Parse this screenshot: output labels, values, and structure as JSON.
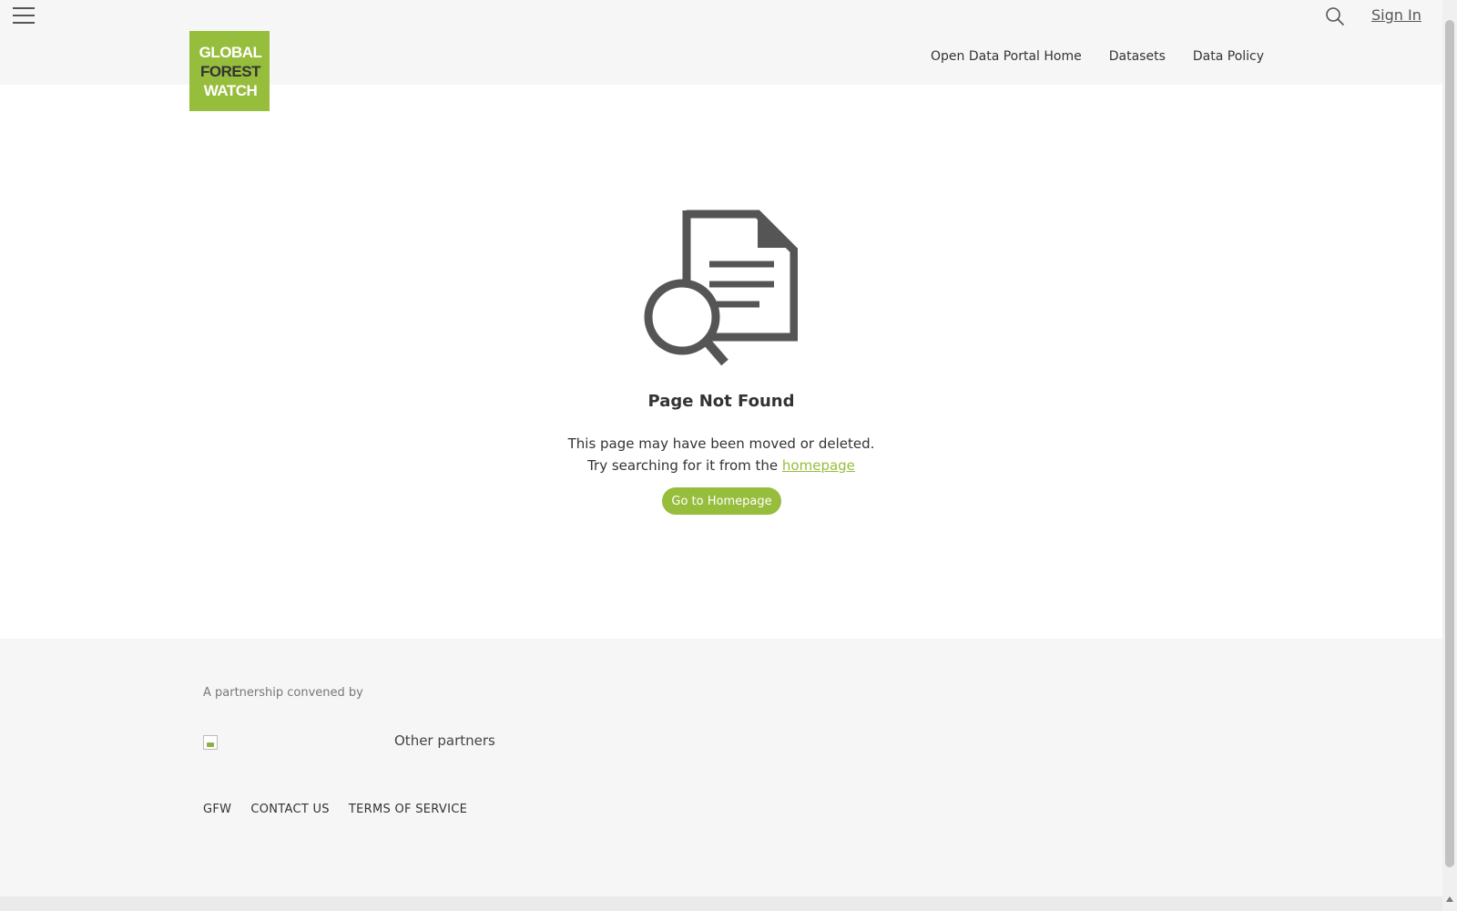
{
  "header": {
    "menu_icon": "hamburger-menu-icon",
    "logo": {
      "lines": [
        "GLOBAL",
        "FOREST",
        "WATCH"
      ],
      "color": "#97bd3d"
    },
    "search_icon": "search-icon",
    "sign_in_label": "Sign In",
    "nav": [
      {
        "label": "Open Data Portal Home"
      },
      {
        "label": "Datasets"
      },
      {
        "label": "Data Policy"
      }
    ]
  },
  "main": {
    "icon": "document-search-icon",
    "title": "Page Not Found",
    "message_line1": "This page may have been moved or deleted.",
    "message_line2_prefix": "Try searching for it from the",
    "message_link": "homepage",
    "button_label": "Go to Homepage"
  },
  "footer": {
    "convened_label": "A partnership convened by",
    "other_partners_label": "Other partners",
    "links": [
      {
        "label": "GFW"
      },
      {
        "label": "CONTACT US"
      },
      {
        "label": "TERMS OF SERVICE"
      }
    ]
  },
  "colors": {
    "accent": "#97bd3d",
    "header_bg": "#f6f6f6",
    "text": "#333333"
  }
}
